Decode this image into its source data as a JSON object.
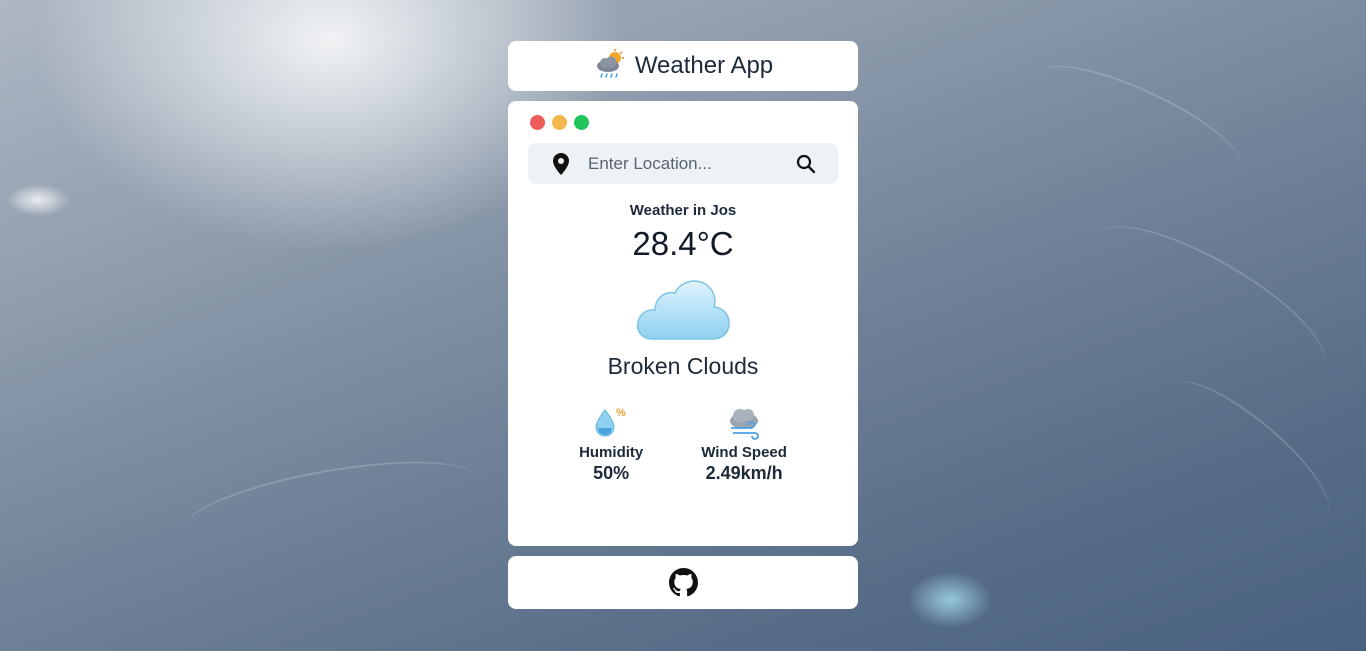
{
  "header": {
    "title": "Weather App",
    "logo_icon": "cloud-sun-rain-icon"
  },
  "window_controls": [
    "close",
    "minimize",
    "maximize"
  ],
  "search": {
    "placeholder": "Enter Location...",
    "value": "",
    "location_icon": "map-pin-icon",
    "search_icon": "search-icon"
  },
  "weather": {
    "title": "Weather in Jos",
    "temperature": "28.4°C",
    "condition_icon": "cloud-icon",
    "description": "Broken Clouds"
  },
  "stats": {
    "humidity": {
      "label": "Humidity",
      "value": "50%",
      "icon": "humidity-drop-icon"
    },
    "wind": {
      "label": "Wind Speed",
      "value": "2.49km/h",
      "icon": "wind-cloud-icon"
    }
  },
  "footer": {
    "icon": "github-icon"
  },
  "colors": {
    "accent_text": "#1d2a3a",
    "dot_red": "#ef5a5a",
    "dot_yellow": "#f2b84b",
    "dot_green": "#1fc45a",
    "search_bg": "#eef2f7"
  }
}
